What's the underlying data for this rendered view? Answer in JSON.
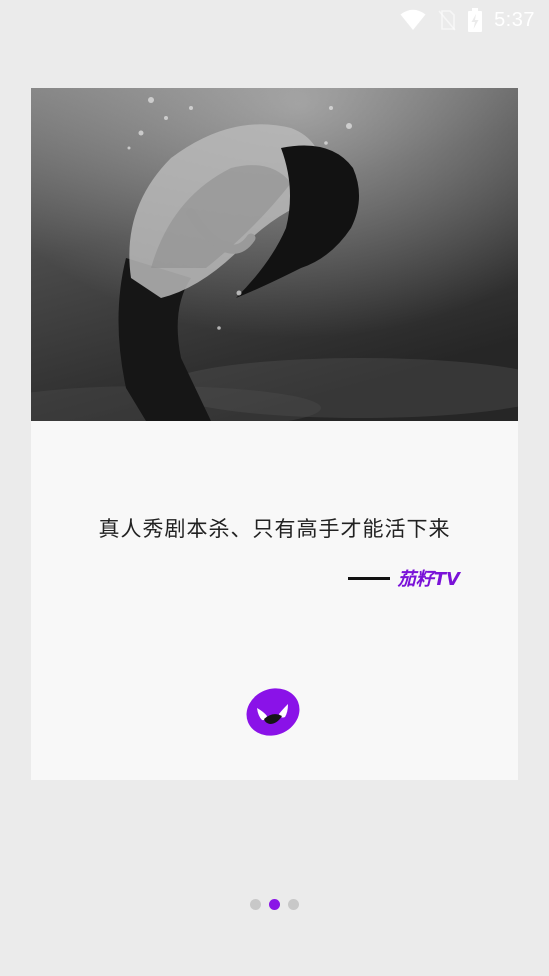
{
  "status_bar": {
    "time": "5:37",
    "icons": [
      "wifi-icon",
      "no-sim-icon",
      "battery-charging-icon"
    ]
  },
  "card": {
    "image": "underwater-woman-photo",
    "slogan": "真人秀剧本杀、只有高手才能活下来",
    "signature_brand": "茄籽TV",
    "logo": "app-logo-icon"
  },
  "pager": {
    "page_count": 3,
    "active_index": 1,
    "active_color": "#8a15e6",
    "inactive_color": "#c8c8c8"
  },
  "colors": {
    "brand": "#7a12d8",
    "background": "#ebebeb",
    "card": "#f8f8f8"
  }
}
